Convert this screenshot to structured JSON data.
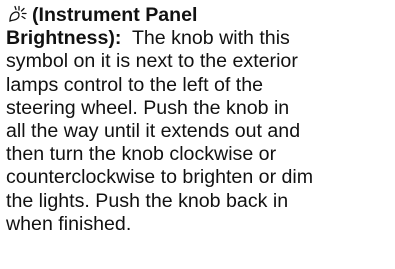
{
  "paragraph": {
    "icon": "instrument-panel-brightness-icon",
    "heading_line1": "(Instrument Panel",
    "heading_line2": "Brightness):",
    "body_line2": "  The knob with this",
    "body_lines": [
      "symbol on it is next to the exterior",
      "lamps control to the left of the",
      "steering wheel. Push the knob in",
      "all the way until it extends out and",
      "then turn the knob clockwise or",
      "counterclockwise to brighten or dim",
      "the lights. Push the knob back in",
      "when finished."
    ]
  }
}
